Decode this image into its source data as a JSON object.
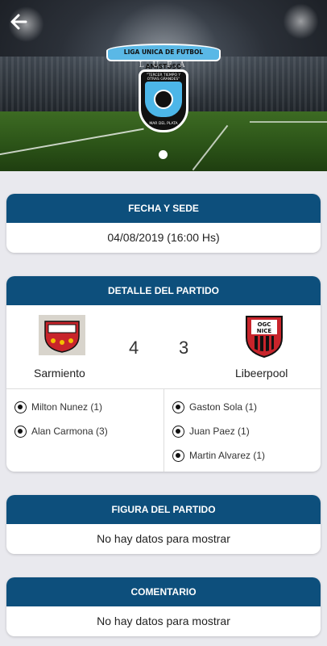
{
  "header": {
    "back_icon": "arrow-left-icon",
    "logo": {
      "ribbon_text": "LIGA UNICA DE FUTBOL AMISTOSO",
      "acronym": "L.U.F.A",
      "shield_top": "\"TERCER TIEMPO Y OTRAS GRANDES\"",
      "shield_bottom": "MAR DEL PLATA"
    },
    "carousel_index": 1
  },
  "fecha": {
    "title": "FECHA Y SEDE",
    "value": "04/08/2019 (16:00 Hs)"
  },
  "detalle": {
    "title": "DETALLE DEL PARTIDO",
    "home": {
      "name": "Sarmiento",
      "score": "4",
      "logo_color": "#c8242b"
    },
    "away": {
      "name": "Libeerpool",
      "score": "3",
      "logo_text": "OGC NICE"
    },
    "home_scorers": [
      "Milton Nunez (1)",
      "Alan Carmona (3)"
    ],
    "away_scorers": [
      "Gaston Sola (1)",
      "Juan Paez (1)",
      "Martin Alvarez (1)"
    ]
  },
  "figura": {
    "title": "FIGURA DEL PARTIDO",
    "value": "No hay datos para mostrar"
  },
  "comentario": {
    "title": "COMENTARIO",
    "value": "No hay datos para mostrar"
  },
  "colors": {
    "card_header": "#0d4f7c",
    "background": "#e9e9ee"
  }
}
